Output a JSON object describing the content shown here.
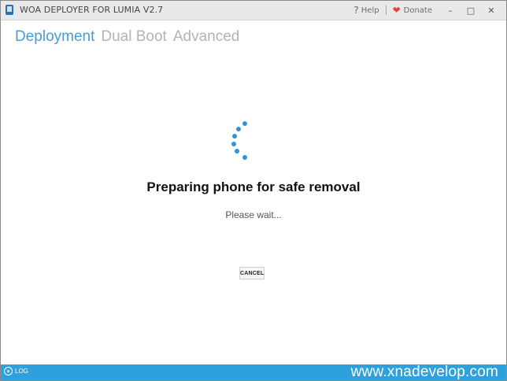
{
  "window": {
    "title": "WOA DEPLOYER FOR LUMIA V2.7",
    "help_label": "Help",
    "donate_label": "Donate",
    "minimize_glyph": "–",
    "maximize_glyph": "□",
    "close_glyph": "✕"
  },
  "tabs": [
    {
      "label": "Deployment",
      "active": true
    },
    {
      "label": "Dual Boot",
      "active": false
    },
    {
      "label": "Advanced",
      "active": false
    }
  ],
  "progress": {
    "heading": "Preparing phone for safe removal",
    "subtext": "Please wait...",
    "cancel_label": "CANCEL"
  },
  "logbar": {
    "label": "LOG",
    "watermark": "www.xnadevelop.com"
  },
  "colors": {
    "accent": "#4a9bd4",
    "logbar": "#2ea0dc",
    "heart": "#e0463e",
    "spinner": "#2f95d6"
  }
}
